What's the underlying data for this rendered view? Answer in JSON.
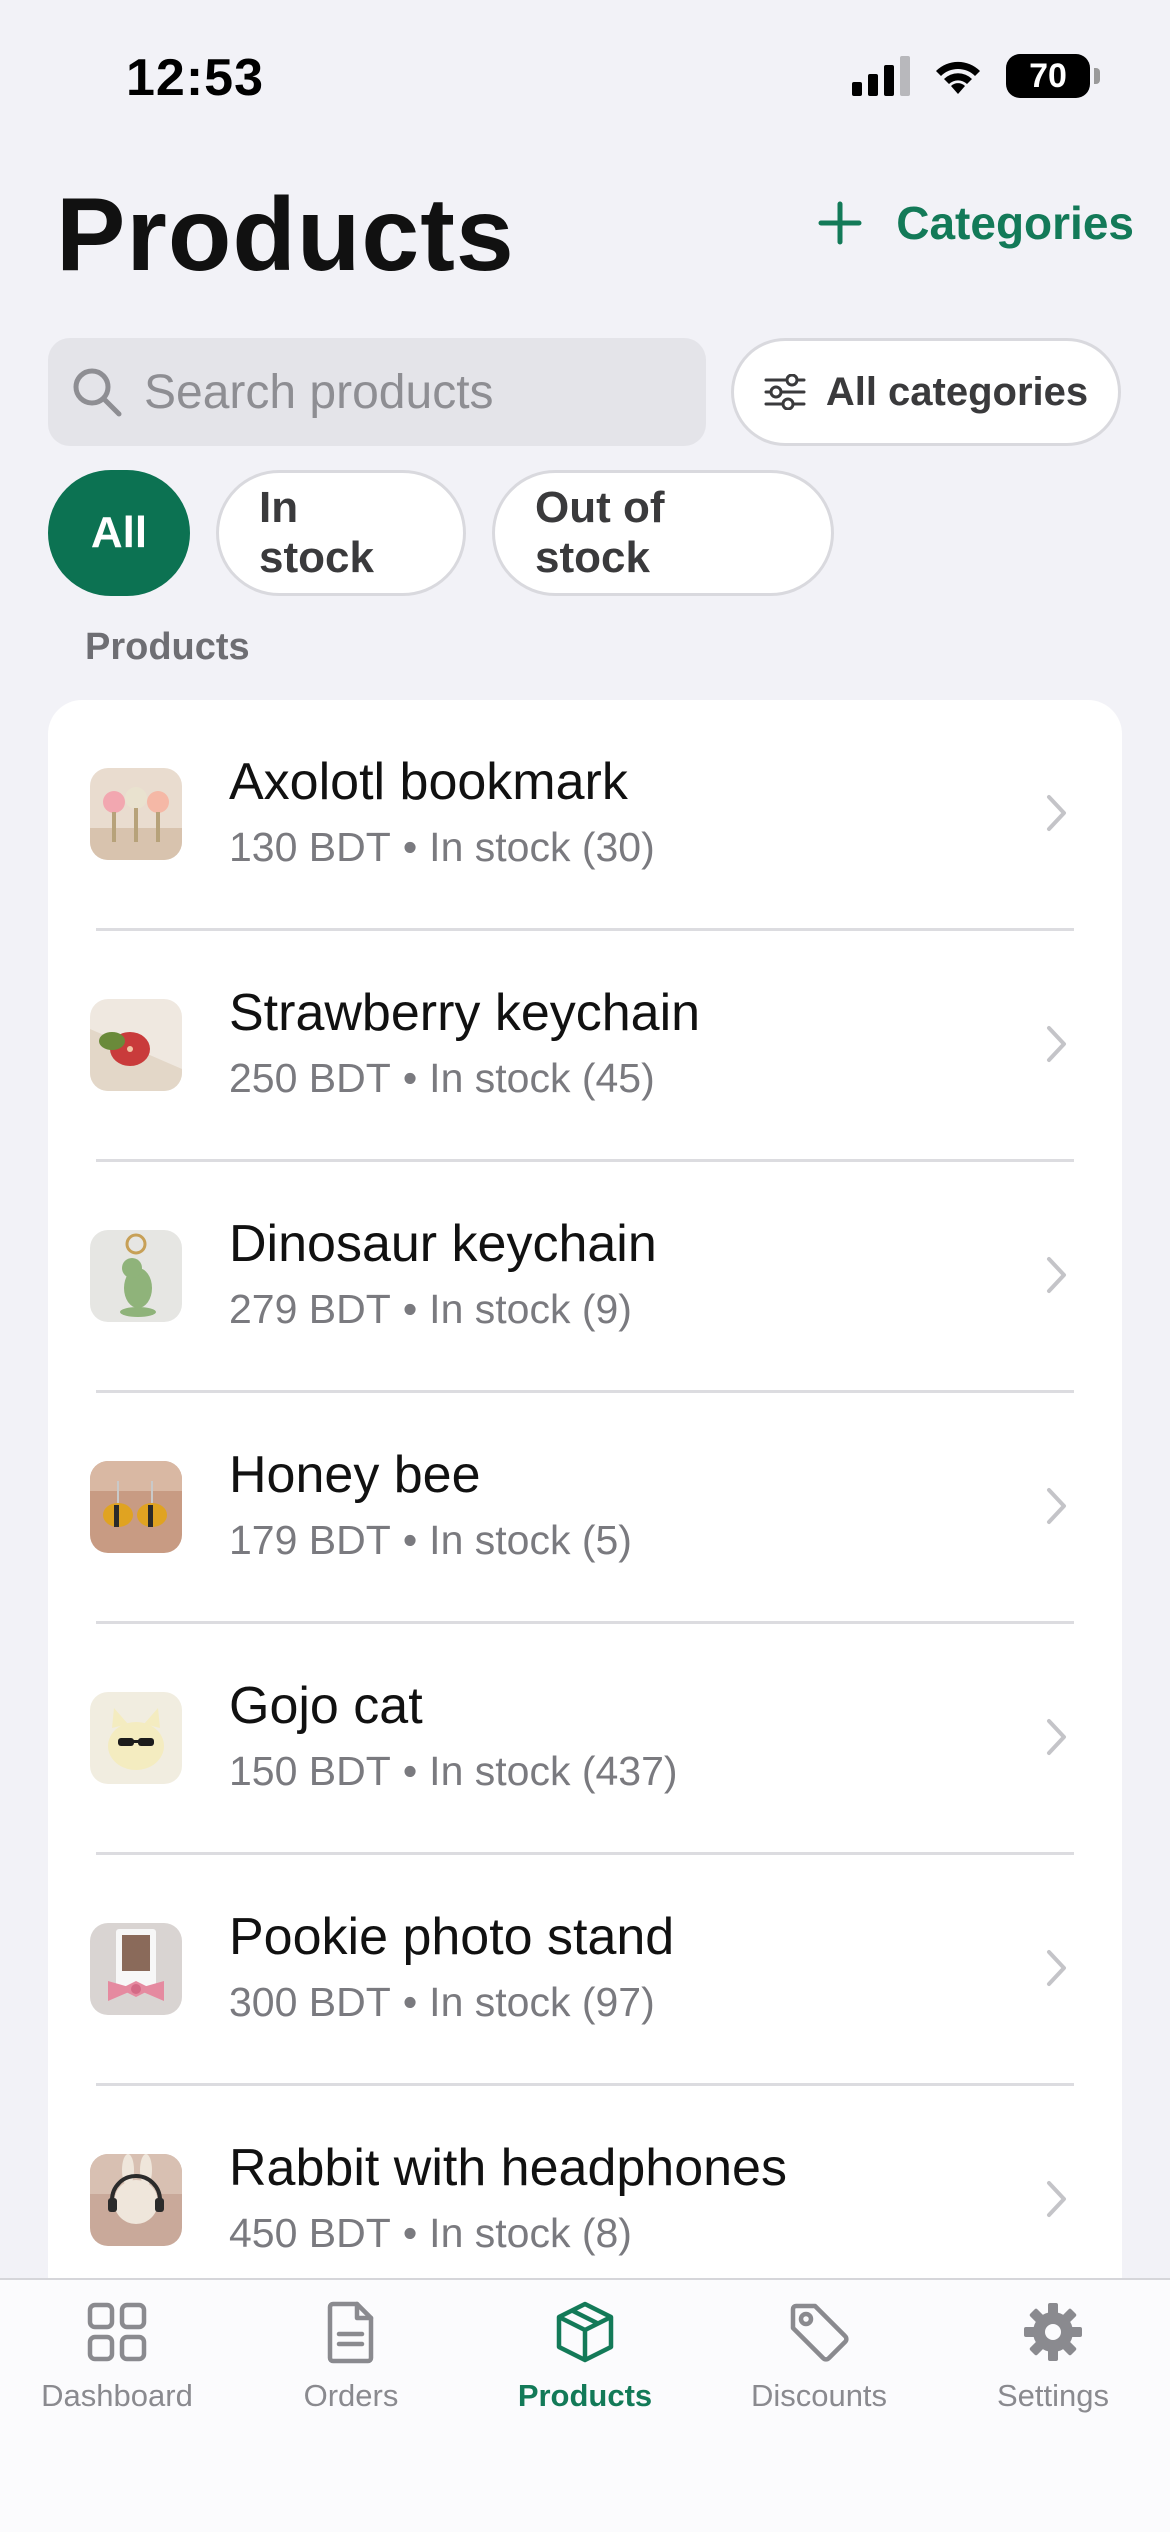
{
  "status_bar": {
    "time": "12:53",
    "battery": "70"
  },
  "header": {
    "title": "Products",
    "categories_button": "Categories"
  },
  "search": {
    "placeholder": "Search products"
  },
  "category_filter": {
    "label": "All categories"
  },
  "stock_filters": [
    {
      "label": "All",
      "selected": true
    },
    {
      "label": "In stock",
      "selected": false
    },
    {
      "label": "Out of stock",
      "selected": false
    }
  ],
  "section_label": "Products",
  "products": [
    {
      "name": "Axolotl bookmark",
      "price": "130 BDT",
      "stock": "In stock (30)"
    },
    {
      "name": "Strawberry keychain",
      "price": "250 BDT",
      "stock": "In stock (45)"
    },
    {
      "name": "Dinosaur keychain",
      "price": "279 BDT",
      "stock": "In stock (9)"
    },
    {
      "name": "Honey bee",
      "price": "179 BDT",
      "stock": "In stock (5)"
    },
    {
      "name": "Gojo cat",
      "price": "150 BDT",
      "stock": "In stock (437)"
    },
    {
      "name": "Pookie photo stand",
      "price": "300 BDT",
      "stock": "In stock (97)"
    },
    {
      "name": "Rabbit with headphones",
      "price": "450 BDT",
      "stock": "In stock (8)"
    }
  ],
  "tab_bar": [
    {
      "label": "Dashboard",
      "icon": "grid-icon",
      "active": false
    },
    {
      "label": "Orders",
      "icon": "document-icon",
      "active": false
    },
    {
      "label": "Products",
      "icon": "box-icon",
      "active": true
    },
    {
      "label": "Discounts",
      "icon": "tag-icon",
      "active": false
    },
    {
      "label": "Settings",
      "icon": "gear-icon",
      "active": false
    }
  ],
  "colors": {
    "accent": "#0c7252",
    "accent_text": "#137a58",
    "background": "#f2f2f7"
  }
}
